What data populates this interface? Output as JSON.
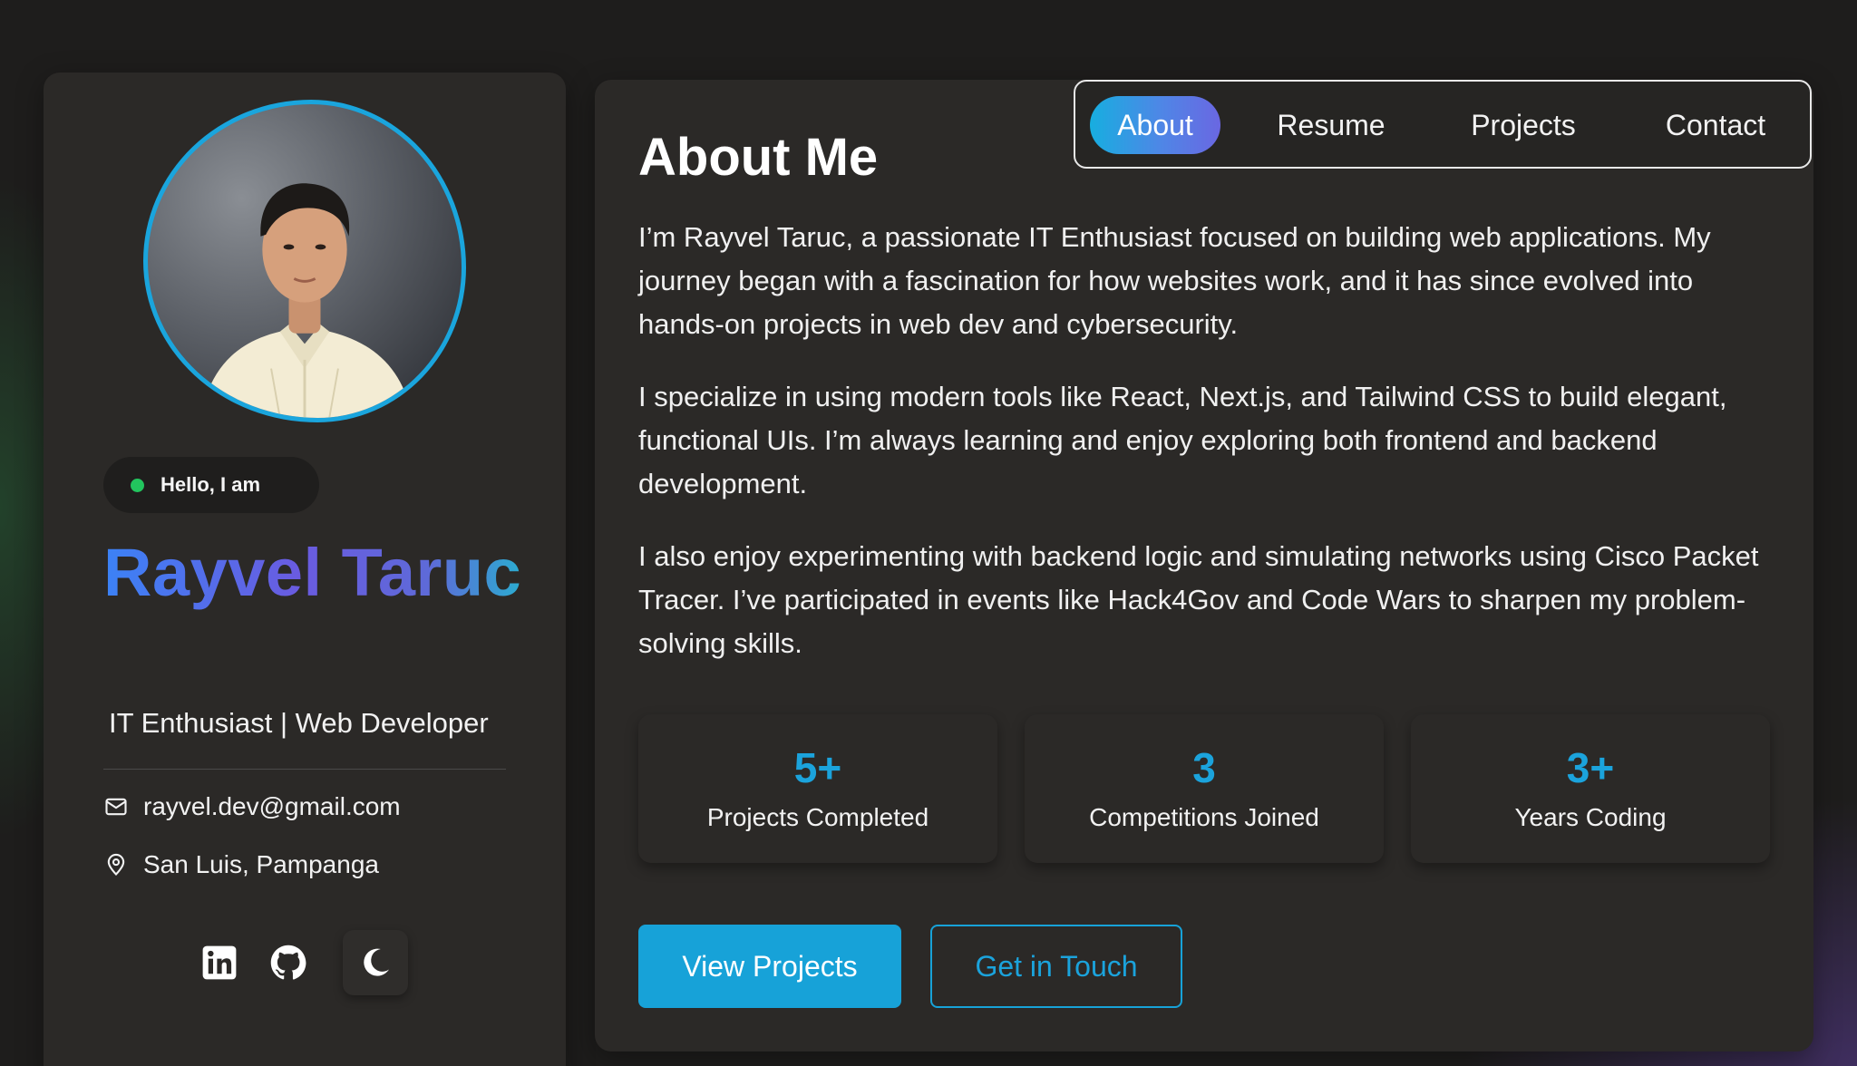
{
  "profile": {
    "greeting": "Hello, I am",
    "name": "Rayvel Taruc",
    "role": "IT Enthusiast | Web Developer",
    "email": "rayvel.dev@gmail.com",
    "location": "San Luis, Pampanga",
    "status_color": "#22c55e"
  },
  "socials": [
    {
      "icon": "linkedin-icon"
    },
    {
      "icon": "github-icon"
    },
    {
      "icon": "moon-icon"
    }
  ],
  "nav": {
    "items": [
      {
        "label": "About",
        "active": true
      },
      {
        "label": "Resume",
        "active": false
      },
      {
        "label": "Projects",
        "active": false
      },
      {
        "label": "Contact",
        "active": false
      }
    ]
  },
  "about": {
    "title": "About Me",
    "paragraphs": [
      "I’m Rayvel Taruc, a passionate IT Enthusiast focused on building web applications. My journey began with a fascination for how websites work, and it has since evolved into hands-on projects in web dev and cybersecurity.",
      "I specialize in using modern tools like React, Next.js, and Tailwind CSS to build elegant, functional UIs. I’m always learning and enjoy exploring both frontend and backend development.",
      "I also enjoy experimenting with backend logic and simulating networks using Cisco Packet Tracer. I’ve participated in events like Hack4Gov and Code Wars to sharpen my problem-solving skills."
    ]
  },
  "stats": [
    {
      "value": "5+",
      "label": "Projects Completed"
    },
    {
      "value": "3",
      "label": "Competitions Joined"
    },
    {
      "value": "3+",
      "label": "Years Coding"
    }
  ],
  "actions": {
    "primary": "View Projects",
    "secondary": "Get in Touch"
  },
  "colors": {
    "accent": "#1ba3dc",
    "background": "#1e1d1c",
    "card": "#2b2927"
  }
}
